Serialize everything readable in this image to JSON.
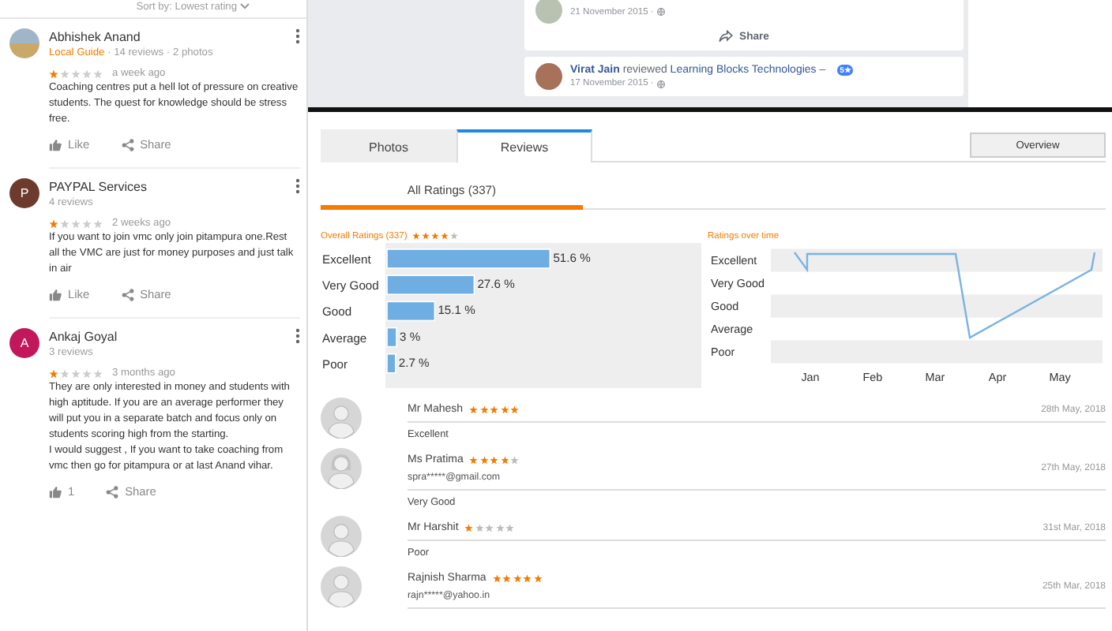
{
  "google_reviews": {
    "sort_label": "Sort by: Lowest rating",
    "reviews": [
      {
        "name": "Abhishek Anand",
        "avatar": {
          "kind": "photo"
        },
        "local_guide": "Local Guide",
        "meta": "· 14 reviews · 2 photos",
        "stars": 1,
        "time": "a week ago",
        "text": "Coaching centres put a hell lot of pressure on creative students. The quest for knowledge should be stress free.",
        "like": "Like",
        "share": "Share"
      },
      {
        "name": "PAYPAL Services",
        "avatar": {
          "kind": "letter",
          "letter": "P",
          "color": "#6d3b2e"
        },
        "meta": "4 reviews",
        "stars": 1,
        "time": "2 weeks ago",
        "text": "If you want to join vmc only join pitampura one.Rest all the VMC are just for money purposes and just talk in air",
        "like": "Like",
        "share": "Share"
      },
      {
        "name": "Ankaj Goyal",
        "avatar": {
          "kind": "letter",
          "letter": "A",
          "color": "#c2185b"
        },
        "meta": "3 reviews",
        "stars": 1,
        "time": "3 months ago",
        "text": "They are only interested in money and students with high aptitude. If you are an average performer they will put you in a separate batch and focus only on students scoring high from the starting.\nI would suggest , If you want to take coaching from vmc then go for pitampura or at last Anand vihar.",
        "like": "1",
        "share": "Share"
      }
    ]
  },
  "facebook_feed": {
    "posts": [
      {
        "kind": "share",
        "date": "21 November 2015 ·",
        "share": "Share"
      },
      {
        "kind": "review",
        "author": "Virat Jain",
        "verb": "reviewed",
        "page": "Learning Blocks Technologies",
        "dash": "–",
        "badge": "5★",
        "date": "17 November 2015 ·"
      }
    ]
  },
  "ratings_panel": {
    "tabs": [
      {
        "label": "Photos",
        "selected": false
      },
      {
        "label": "Reviews",
        "selected": true
      }
    ],
    "overview_button": "Overview",
    "subtabs": [
      {
        "label": "All Ratings (337)",
        "selected": true
      }
    ],
    "overall": {
      "title": "Overall Ratings (337)",
      "stars": 4,
      "chart_data": {
        "type": "bar",
        "orientation": "horizontal",
        "categories": [
          "Excellent",
          "Very Good",
          "Good",
          "Average",
          "Poor"
        ],
        "values": [
          51.6,
          27.6,
          15.1,
          3,
          2.7
        ],
        "xlim": [
          0,
          100
        ],
        "value_labels": [
          "51.6 %",
          "27.6 %",
          "15.1 %",
          "3 %",
          "2.7 %"
        ]
      }
    },
    "over_time": {
      "title": "Ratings over time",
      "y_labels": [
        "Excellent",
        "Very Good",
        "Good",
        "Average",
        "Poor"
      ],
      "x_labels": [
        "Jan",
        "Feb",
        "Mar",
        "Apr",
        "May"
      ]
    },
    "reviews": [
      {
        "name": "Mr Mahesh",
        "stars": 5,
        "date": "28th May, 2018",
        "kind": "male",
        "comment": "Excellent"
      },
      {
        "name": "Ms Pratima",
        "stars": 4,
        "date": "27th May, 2018",
        "kind": "female",
        "email": "spra*****@gmail.com",
        "comment": "Very Good"
      },
      {
        "name": "Mr Harshit",
        "stars": 1,
        "date": "31st Mar, 2018",
        "kind": "male",
        "comment": "Poor"
      },
      {
        "name": "Rajnish Sharma",
        "stars": 5,
        "date": "25th Mar, 2018",
        "kind": "male",
        "email": "rajn*****@yahoo.in"
      }
    ]
  }
}
